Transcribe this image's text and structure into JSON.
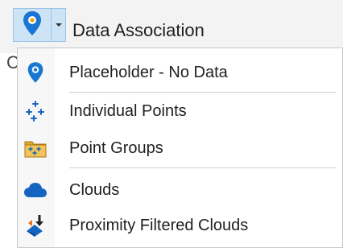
{
  "toolbar": {
    "button_label": "Data Association",
    "clipped_text": "C"
  },
  "menu": {
    "items": [
      {
        "label": "Placeholder - No Data",
        "icon": "map-pin-icon"
      },
      {
        "label": "Individual Points",
        "icon": "scattered-points-icon"
      },
      {
        "label": "Point Groups",
        "icon": "point-groups-icon"
      },
      {
        "label": "Clouds",
        "icon": "cloud-icon"
      },
      {
        "label": "Proximity Filtered Clouds",
        "icon": "proximity-filter-icon"
      }
    ]
  },
  "colors": {
    "accent_blue": "#1e88d6",
    "pin_blue": "#1976d2",
    "cloud_blue": "#1565c0",
    "folder_gold": "#e0a82e",
    "arrow_orange": "#e8731a",
    "button_highlight": "#cde4f7"
  }
}
